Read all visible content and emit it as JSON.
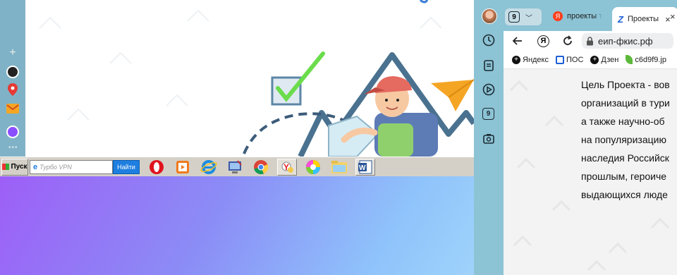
{
  "taskbar": {
    "start_label": "Пуск",
    "search_placeholder": "Турбо VPN",
    "search_button": "Найти",
    "apps": [
      {
        "name": "opera-icon"
      },
      {
        "name": "media-player-icon"
      },
      {
        "name": "internet-explorer-icon"
      },
      {
        "name": "pc-settings-icon"
      },
      {
        "name": "chrome-icon"
      },
      {
        "name": "yandex-browser-icon"
      },
      {
        "name": "color-wheel-icon"
      },
      {
        "name": "folder-icon"
      },
      {
        "name": "word-icon"
      }
    ]
  },
  "right_browser": {
    "tab_counter": "9",
    "tabs": [
      {
        "label": "проекты т",
        "favicon": "Я"
      },
      {
        "label": "Проекты",
        "close": "×",
        "active": true
      },
      {
        "close": "×"
      }
    ],
    "address": "еип-фкис.рф",
    "bookmarks": [
      {
        "label": "Яндекс",
        "icon": "plus-icon"
      },
      {
        "label": "ПОС",
        "icon": "gosuslugi-icon"
      },
      {
        "label": "Дзен",
        "icon": "plus-icon"
      },
      {
        "label": "c6d9f9.jp",
        "icon": "leaf-icon"
      }
    ],
    "sidebar_badge": "9",
    "content_lines": [
      "Цель Проекта - вов",
      "организаций в тури",
      "а также научно-об",
      "на популяризацию",
      "наследия Российск",
      "прошлым, героиче",
      "выдающихся люде"
    ]
  },
  "colors": {
    "sidebar": "#8cc3d5",
    "left_strip": "#7fb2c6",
    "accent_red": "#e84a3c",
    "search_button": "#1e7fe0"
  }
}
